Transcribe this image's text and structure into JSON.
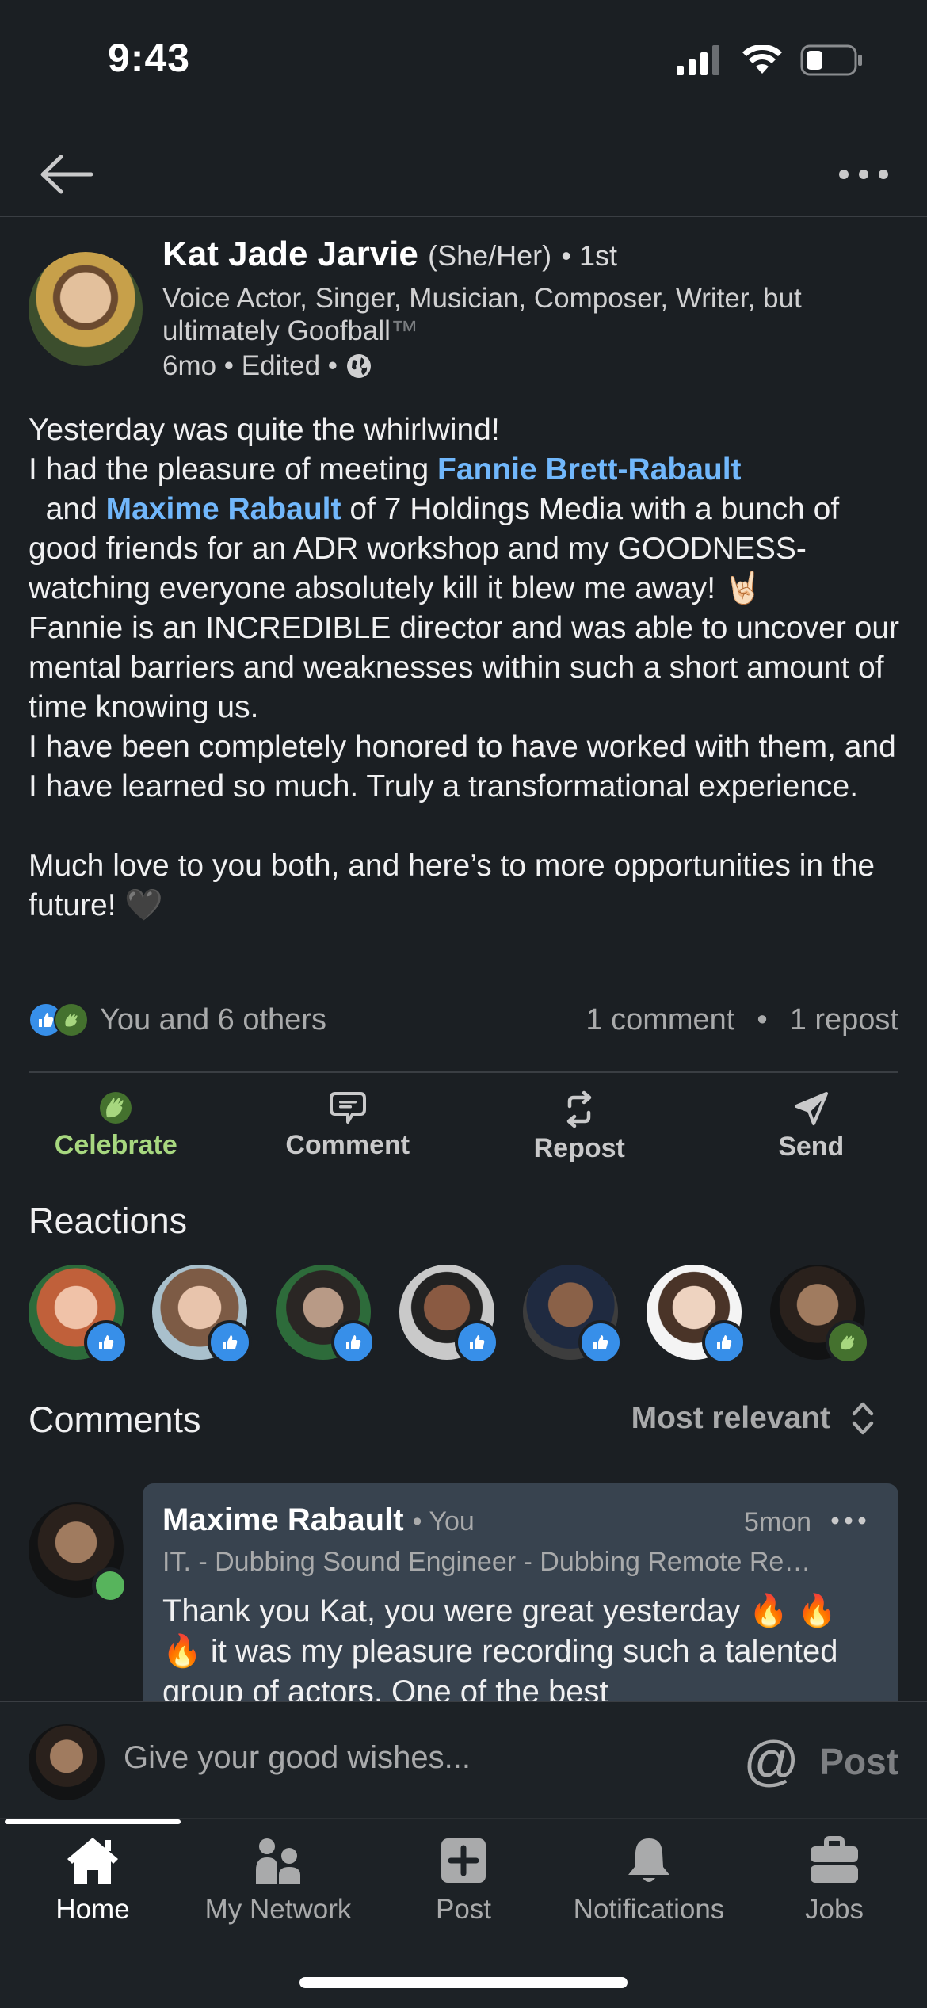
{
  "status_bar": {
    "time": "9:43"
  },
  "author": {
    "name": "Kat Jade Jarvie",
    "pronouns": "(She/Her)",
    "degree": "• 1st",
    "headline": "Voice Actor, Singer, Musician, Composer, Writer, but ultimately Goofball",
    "headline_tm": "™",
    "meta": "6mo • Edited •"
  },
  "post": {
    "line1": "Yesterday was quite the whirlwind!",
    "line2_pre": "I had the pleasure of meeting ",
    "mention1": "Fannie Brett-Rabault",
    "line2_mid": "  and ",
    "mention2": "Maxime Rabault",
    "line2_post": " of 7 Holdings Media with a bunch of good friends for an ADR workshop and my GOODNESS- watching everyone absolutely kill it blew me away! 🤘🏻",
    "line3": "Fannie is an INCREDIBLE director and was able to uncover our mental barriers and weaknesses within such a short amount of time knowing us.",
    "line4": "I have been completely honored to have worked with them, and I have learned so much. Truly a transformational experience.",
    "line5": "Much love to you both, and here’s to more opportunities in the future! 🖤"
  },
  "social": {
    "reactions_text": "You and 6 others",
    "comments_text": "1 comment",
    "separator": "•",
    "reposts_text": "1 repost"
  },
  "actions": [
    {
      "label": "Celebrate",
      "icon": "celebrate-icon"
    },
    {
      "label": "Comment",
      "icon": "comment-icon"
    },
    {
      "label": "Repost",
      "icon": "repost-icon"
    },
    {
      "label": "Send",
      "icon": "send-icon"
    }
  ],
  "reactions": {
    "title": "Reactions",
    "reactors": [
      {
        "type": "like",
        "color": "#d88a6a"
      },
      {
        "type": "like",
        "color": "#b98f7a"
      },
      {
        "type": "like",
        "color": "#7d6a5a"
      },
      {
        "type": "like",
        "color": "#6d4a3a"
      },
      {
        "type": "like",
        "color": "#5a4536"
      },
      {
        "type": "like",
        "color": "#d9c0ab"
      },
      {
        "type": "celebrate",
        "color": "#3a2e28"
      }
    ]
  },
  "comments": {
    "title": "Comments",
    "sort_label": "Most relevant",
    "items": [
      {
        "name": "Maxime Rabault",
        "you_tag": "• You",
        "time": "5mon",
        "headline": "IT. - Dubbing Sound Engineer - Dubbing Remote Recording Studio",
        "text": "Thank you Kat, you were great yesterday 🔥 🔥 🔥 it was my pleasure recording such a talented group of actors. One of the best"
      }
    ]
  },
  "composer": {
    "placeholder": "Give your good wishes...",
    "at_symbol": "@",
    "post_label": "Post"
  },
  "nav": [
    {
      "label": "Home",
      "icon": "home-icon",
      "active": true
    },
    {
      "label": "My Network",
      "icon": "network-icon",
      "active": false
    },
    {
      "label": "Post",
      "icon": "post-plus-icon",
      "active": false
    },
    {
      "label": "Notifications",
      "icon": "bell-icon",
      "active": false
    },
    {
      "label": "Jobs",
      "icon": "briefcase-icon",
      "active": false
    }
  ],
  "colors": {
    "background": "#1b1f23",
    "link": "#71b7fb",
    "celebrate": "#a7d77f",
    "like": "#378fe9"
  }
}
